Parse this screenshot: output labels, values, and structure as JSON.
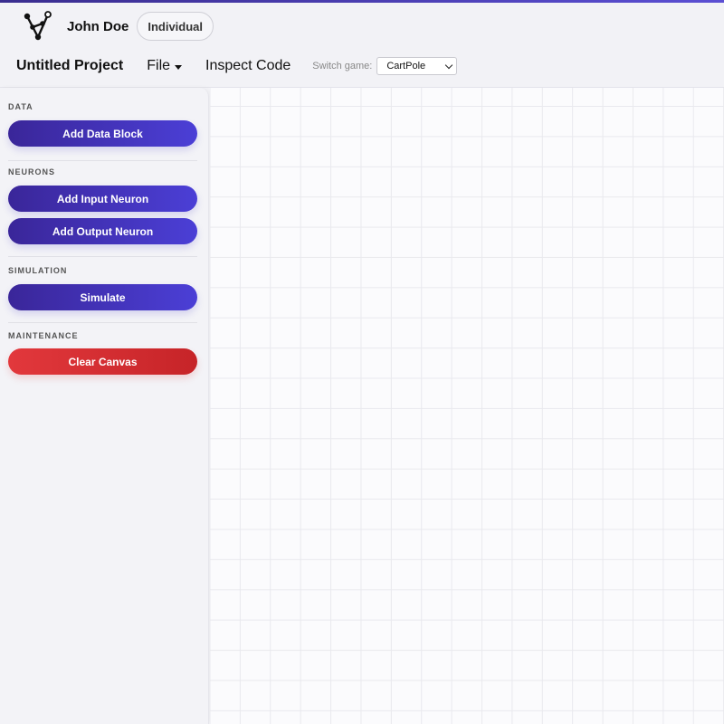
{
  "user": {
    "name": "John Doe",
    "plan": "Individual"
  },
  "menu": {
    "project_title": "Untitled Project",
    "file": "File",
    "inspect": "Inspect Code",
    "switch_label": "Switch game:",
    "game_selected": "CartPole"
  },
  "sidebar": {
    "sections": {
      "data": "DATA",
      "neurons": "NEURONS",
      "simulation": "SIMULATION",
      "maintenance": "MAINTENANCE"
    },
    "buttons": {
      "add_data": "Add Data Block",
      "add_input": "Add Input Neuron",
      "add_output": "Add Output Neuron",
      "simulate": "Simulate",
      "clear": "Clear Canvas"
    }
  },
  "colors": {
    "primary": "#4334c4",
    "danger": "#d8302f"
  }
}
